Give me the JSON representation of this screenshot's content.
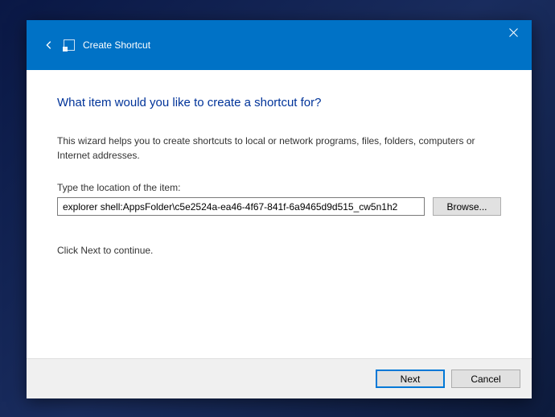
{
  "titlebar": {
    "title": "Create Shortcut"
  },
  "content": {
    "heading": "What item would you like to create a shortcut for?",
    "description": "This wizard helps you to create shortcuts to local or network programs, files, folders, computers or Internet addresses.",
    "field_label": "Type the location of the item:",
    "location_value": "explorer shell:AppsFolder\\c5e2524a-ea46-4f67-841f-6a9465d9d515_cw5n1h2",
    "browse_label": "Browse...",
    "continue_text": "Click Next to continue."
  },
  "footer": {
    "next_label": "Next",
    "cancel_label": "Cancel"
  }
}
